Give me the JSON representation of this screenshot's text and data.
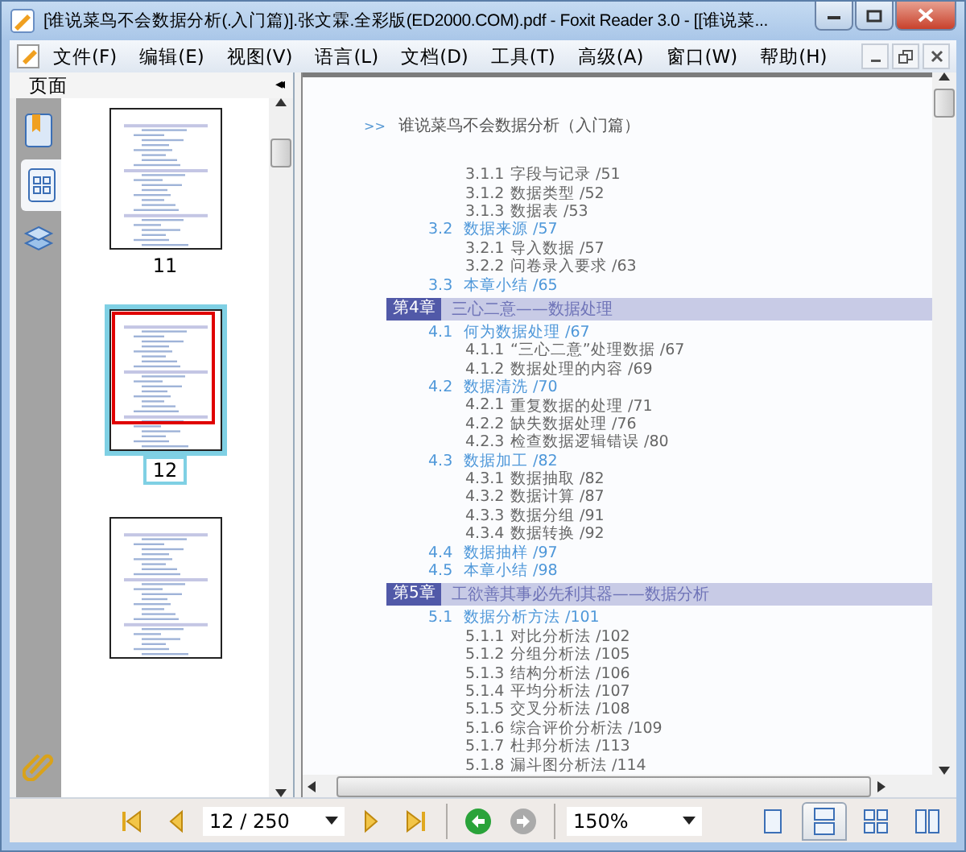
{
  "window": {
    "title": "[谁说菜鸟不会数据分析(.入门篇)].张文霖.全彩版(ED2000.COM).pdf - Foxit Reader 3.0 - [[谁说菜..."
  },
  "menu": [
    "文件(F)",
    "编辑(E)",
    "视图(V)",
    "语言(L)",
    "文档(D)",
    "工具(T)",
    "高级(A)",
    "窗口(W)",
    "帮助(H)"
  ],
  "sidebar": {
    "title": "页面",
    "collapse": "◂◂",
    "tabs": [
      {
        "kind": "bookmarks",
        "selected": false
      },
      {
        "kind": "pages",
        "selected": true
      },
      {
        "kind": "layers",
        "selected": false
      },
      {
        "kind": "attachments",
        "selected": false
      }
    ],
    "thumbnails": [
      {
        "label": "11",
        "selected": false
      },
      {
        "label": "12",
        "selected": true
      },
      {
        "selected": false
      }
    ]
  },
  "document": {
    "header_mark": ">>",
    "header": "谁说菜鸟不会数据分析（入门篇）",
    "toc": [
      {
        "kind": "item",
        "num": "3.1.1",
        "title": "字段与记录 /51"
      },
      {
        "kind": "item",
        "num": "3.1.2",
        "title": "数据类型 /52"
      },
      {
        "kind": "item",
        "num": "3.1.3",
        "title": "数据表 /53"
      },
      {
        "kind": "section",
        "num": "3.2",
        "title": "数据来源 /57"
      },
      {
        "kind": "item",
        "num": "3.2.1",
        "title": "导入数据 /57"
      },
      {
        "kind": "item",
        "num": "3.2.2",
        "title": "问卷录入要求 /63"
      },
      {
        "kind": "section",
        "num": "3.3",
        "title": "本章小结 /65"
      },
      {
        "kind": "chapter",
        "num": "第4章",
        "title": "三心二意——数据处理"
      },
      {
        "kind": "section",
        "num": "4.1",
        "title": "何为数据处理 /67"
      },
      {
        "kind": "item",
        "num": "4.1.1",
        "title": "“三心二意”处理数据 /67"
      },
      {
        "kind": "item",
        "num": "4.1.2",
        "title": "数据处理的内容 /69"
      },
      {
        "kind": "section",
        "num": "4.2",
        "title": "数据清洗 /70"
      },
      {
        "kind": "item",
        "num": "4.2.1",
        "title": "重复数据的处理 /71"
      },
      {
        "kind": "item",
        "num": "4.2.2",
        "title": "缺失数据处理 /76"
      },
      {
        "kind": "item",
        "num": "4.2.3",
        "title": "检查数据逻辑错误 /80"
      },
      {
        "kind": "section",
        "num": "4.3",
        "title": "数据加工 /82"
      },
      {
        "kind": "item",
        "num": "4.3.1",
        "title": "数据抽取 /82"
      },
      {
        "kind": "item",
        "num": "4.3.2",
        "title": "数据计算 /87"
      },
      {
        "kind": "item",
        "num": "4.3.3",
        "title": "数据分组 /91"
      },
      {
        "kind": "item",
        "num": "4.3.4",
        "title": "数据转换 /92"
      },
      {
        "kind": "section",
        "num": "4.4",
        "title": "数据抽样 /97"
      },
      {
        "kind": "section",
        "num": "4.5",
        "title": "本章小结 /98"
      },
      {
        "kind": "chapter",
        "num": "第5章",
        "title": "工欲善其事必先利其器——数据分析"
      },
      {
        "kind": "section",
        "num": "5.1",
        "title": "数据分析方法 /101"
      },
      {
        "kind": "item",
        "num": "5.1.1",
        "title": "对比分析法 /102"
      },
      {
        "kind": "item",
        "num": "5.1.2",
        "title": "分组分析法 /105"
      },
      {
        "kind": "item",
        "num": "5.1.3",
        "title": "结构分析法 /106"
      },
      {
        "kind": "item",
        "num": "5.1.4",
        "title": "平均分析法 /107"
      },
      {
        "kind": "item",
        "num": "5.1.5",
        "title": "交叉分析法 /108"
      },
      {
        "kind": "item",
        "num": "5.1.6",
        "title": "综合评价分析法 /109"
      },
      {
        "kind": "item",
        "num": "5.1.7",
        "title": "杜邦分析法 /113"
      },
      {
        "kind": "item",
        "num": "5.1.8",
        "title": "漏斗图分析法 /114"
      }
    ]
  },
  "toolbar": {
    "page": "12 / 250",
    "zoom": "150%",
    "back_disabled": false,
    "forward_disabled": true,
    "views": [
      {
        "kind": "single",
        "selected": false
      },
      {
        "kind": "continuous",
        "selected": true
      },
      {
        "kind": "facing-continuous",
        "selected": false
      },
      {
        "kind": "facing",
        "selected": false
      }
    ]
  }
}
